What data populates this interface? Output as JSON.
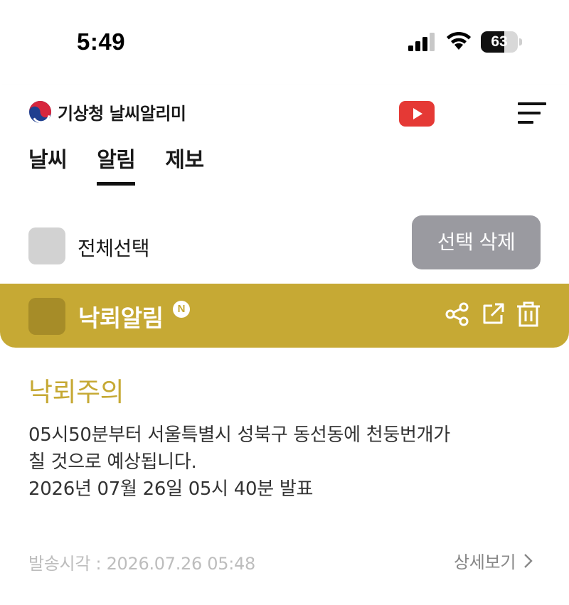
{
  "status_bar": {
    "time": "5:49",
    "battery_level": "63",
    "battery_fraction": 0.63
  },
  "header": {
    "brand_title": "기상청 날씨알리미",
    "tabs": [
      {
        "label": "날씨",
        "active": false
      },
      {
        "label": "알림",
        "active": true
      },
      {
        "label": "제보",
        "active": false
      }
    ],
    "icons": [
      "taegeuk-icon",
      "youtube-icon",
      "menu-icon"
    ]
  },
  "selection": {
    "select_all_label": "전체선택",
    "delete_selected_label": "선택 삭제"
  },
  "alert": {
    "title": "낙뢰알림",
    "new_badge": "N",
    "headline": "낙뢰주의",
    "message": "05시50분부터 서울특별시 성북구 동선동에 천둥번개가\n칠 것으로 예상됩니다.\n2026년 07월 26일 05시 40분 발표",
    "sent_time": "발송시각 : 2026.07.26 05:48",
    "detail_label": "상세보기",
    "actions": [
      "share-icon",
      "external-link-icon",
      "trash-icon"
    ]
  },
  "colors": {
    "accent_gold": "#c6a934",
    "checkbox_gold_dark": "#a68c28",
    "button_gray": "#9a9aa0",
    "youtube_red": "#e53935"
  }
}
